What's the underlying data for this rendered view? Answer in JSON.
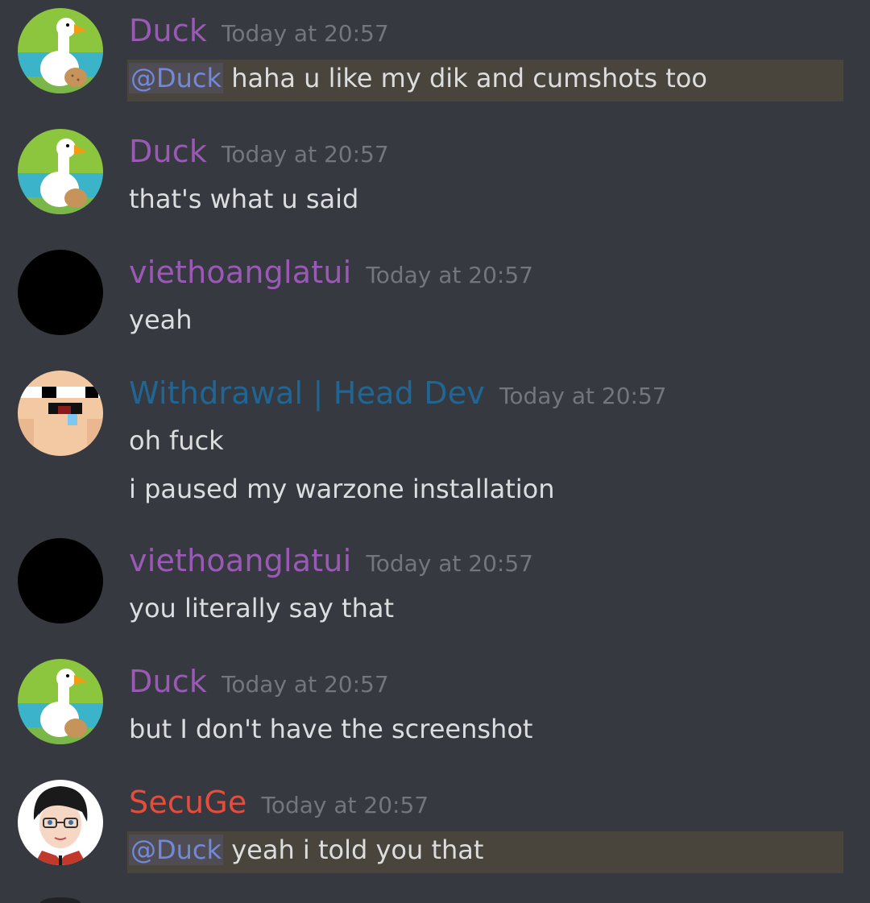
{
  "colors": {
    "background": "#36393f",
    "purple_role": "#9b59b6",
    "blue_role": "#206694",
    "red_role": "#e74c3c",
    "timestamp": "#72767d",
    "message_text": "#dcddde",
    "mention": "#7289da",
    "mention_highlight": "#49443c"
  },
  "messages": [
    {
      "author": "Duck",
      "timestamp": "Today at 20:57",
      "avatar_icon": "goose-avatar-icon",
      "mention": "@Duck",
      "lines": [
        " haha u like my dik and cumshots too"
      ]
    },
    {
      "author": "Duck",
      "timestamp": "Today at 20:57",
      "avatar_icon": "goose-avatar-icon",
      "lines": [
        "that's what u said"
      ]
    },
    {
      "author": "viethoanglatui",
      "timestamp": "Today at 20:57",
      "avatar_icon": "black-circle-avatar-icon",
      "lines": [
        "yeah"
      ]
    },
    {
      "author": "Withdrawal | Head Dev",
      "timestamp": "Today at 20:57",
      "avatar_icon": "pixel-face-avatar-icon",
      "lines": [
        "oh fuck",
        "i paused my warzone installation"
      ]
    },
    {
      "author": "viethoanglatui",
      "timestamp": "Today at 20:57",
      "avatar_icon": "black-circle-avatar-icon",
      "lines": [
        "you literally say that"
      ]
    },
    {
      "author": "Duck",
      "timestamp": "Today at 20:57",
      "avatar_icon": "goose-avatar-icon",
      "lines": [
        "but I don't have the screenshot"
      ]
    },
    {
      "author": "SecuGe",
      "timestamp": "Today at 20:57",
      "avatar_icon": "anime-boy-avatar-icon",
      "mention": "@Duck",
      "lines": [
        " yeah i told you that"
      ]
    }
  ]
}
